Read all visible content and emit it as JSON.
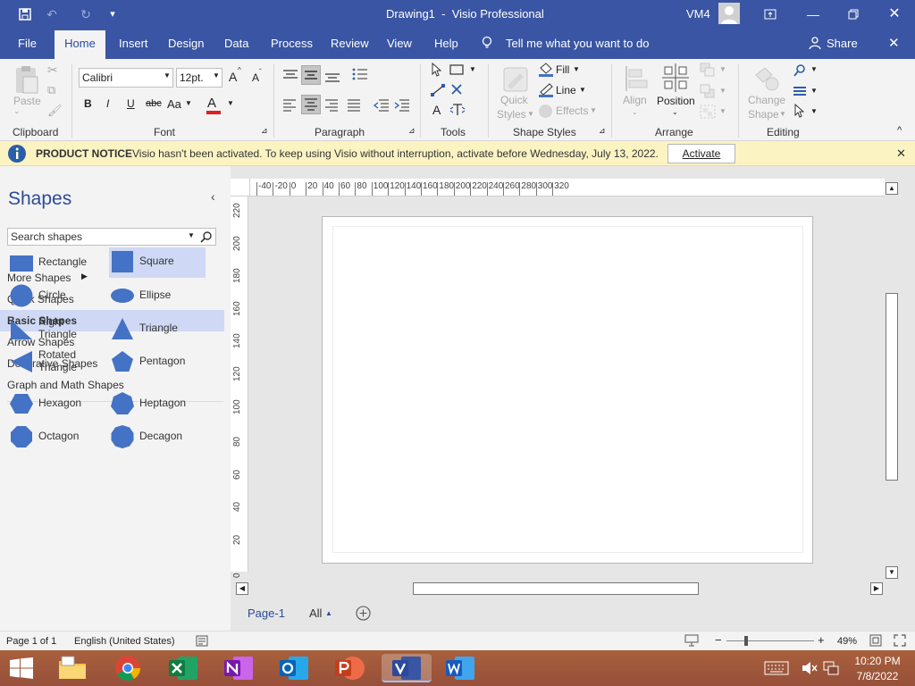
{
  "window": {
    "title": "Drawing1  -  Visio Professional",
    "user": "VM4"
  },
  "tabs": [
    "File",
    "Home",
    "Insert",
    "Design",
    "Data",
    "Process",
    "Review",
    "View",
    "Help"
  ],
  "tell_me": "Tell me what you want to do",
  "share": "Share",
  "ribbon": {
    "clipboard": {
      "paste": "Paste",
      "label": "Clipboard"
    },
    "font": {
      "family": "Calibri",
      "size": "12pt.",
      "label": "Font",
      "bold": "B",
      "italic": "I",
      "underline": "U",
      "strike": "abc",
      "case": "Aa",
      "color_letter": "A",
      "grow": "A",
      "shrink": "A"
    },
    "paragraph": {
      "label": "Paragraph"
    },
    "tools": {
      "label": "Tools",
      "text": "A"
    },
    "shape_styles": {
      "quick": "Quick",
      "styles": "Styles",
      "fill": "Fill",
      "line": "Line",
      "effects": "Effects",
      "label": "Shape Styles"
    },
    "arrange": {
      "align": "Align",
      "position": "Position",
      "label": "Arrange"
    },
    "editing": {
      "change": "Change",
      "shape": "Shape",
      "label": "Editing"
    }
  },
  "notice": {
    "title": "PRODUCT NOTICE",
    "text": "Visio hasn't been activated. To keep using Visio without interruption, activate before Wednesday, July 13, 2022.",
    "button": "Activate"
  },
  "shapes": {
    "title": "Shapes",
    "search_placeholder": "Search shapes",
    "nav": [
      "More Shapes",
      "Quick Shapes",
      "Basic Shapes",
      "Arrow Shapes",
      "Decorative Shapes",
      "Graph and Math Shapes"
    ],
    "selected_nav": "Basic Shapes",
    "stencil": [
      {
        "name": "Rectangle",
        "icon": "rectangle-shape-icon"
      },
      {
        "name": "Square",
        "icon": "square-shape-icon"
      },
      {
        "name": "Circle",
        "icon": "circle-shape-icon"
      },
      {
        "name": "Ellipse",
        "icon": "ellipse-shape-icon"
      },
      {
        "name": "Right\nTriangle",
        "icon": "right-triangle-shape-icon"
      },
      {
        "name": "Triangle",
        "icon": "triangle-shape-icon"
      },
      {
        "name": "Rotated\nTriangle",
        "icon": "rotated-triangle-shape-icon"
      },
      {
        "name": "Pentagon",
        "icon": "pentagon-shape-icon"
      },
      {
        "name": "Hexagon",
        "icon": "hexagon-shape-icon"
      },
      {
        "name": "Heptagon",
        "icon": "heptagon-shape-icon"
      },
      {
        "name": "Octagon",
        "icon": "octagon-shape-icon"
      },
      {
        "name": "Decagon",
        "icon": "decagon-shape-icon"
      }
    ]
  },
  "rulers": {
    "h": [
      "-40",
      "-20",
      "0",
      "20",
      "40",
      "60",
      "80",
      "100",
      "120",
      "140",
      "160",
      "180",
      "200",
      "220",
      "240",
      "260",
      "280",
      "300",
      "320"
    ],
    "v": [
      "220",
      "200",
      "180",
      "160",
      "140",
      "120",
      "100",
      "80",
      "60",
      "40",
      "20",
      "0"
    ]
  },
  "pages": {
    "current": "Page-1",
    "all": "All"
  },
  "status": {
    "page": "Page 1 of 1",
    "language": "English (United States)",
    "zoom": "49%",
    "zoom_minus": "−",
    "zoom_plus": "+"
  },
  "taskbar": {
    "time": "10:20 PM",
    "date": "7/8/2022"
  },
  "colors": {
    "accent": "#3955a3",
    "shape_fill": "#4472c4",
    "notice_bg": "#fcf3c3"
  }
}
